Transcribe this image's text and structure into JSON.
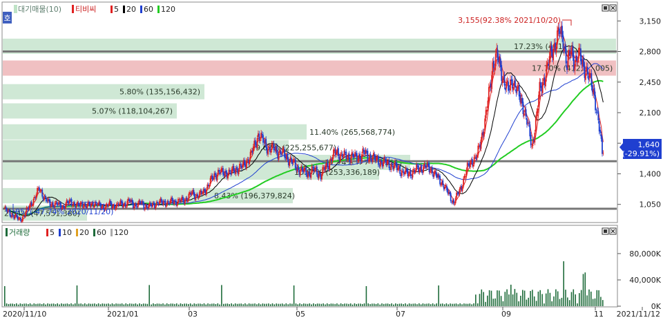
{
  "legend_price": {
    "marker": "호",
    "vp_label": "대기매물(10)",
    "candle_label": "티비씨",
    "ma": [
      {
        "label": "5",
        "color": "#e02020"
      },
      {
        "label": "20",
        "color": "#000000"
      },
      {
        "label": "60",
        "color": "#1f3fd0"
      },
      {
        "label": "120",
        "color": "#22cc22"
      }
    ]
  },
  "legend_volume": {
    "label": "거래량",
    "ma": [
      {
        "label": "5",
        "color": "#e02020"
      },
      {
        "label": "10",
        "color": "#1f3fd0"
      },
      {
        "label": "20",
        "color": "#e0a020"
      },
      {
        "label": "60",
        "color": "#1e6b3a"
      },
      {
        "label": "120",
        "color": "#aaaaaa"
      }
    ]
  },
  "price_axis": {
    "ticks": [
      "3,150",
      "2,800",
      "2,450",
      "2,100",
      "1,750",
      "1,400",
      "1,050"
    ],
    "tick_values": [
      3150,
      2800,
      2450,
      2100,
      1750,
      1400,
      1050
    ],
    "range": [
      850,
      3350
    ]
  },
  "volume_axis": {
    "ticks": [
      "80,000K",
      "40,000K",
      "0K"
    ],
    "tick_values": [
      80000,
      40000,
      0
    ],
    "range": [
      0,
      122000
    ]
  },
  "x_labels": [
    "2020/11/10",
    "2021/01",
    "03",
    "05",
    "07",
    "09",
    "11",
    "2021/11/12"
  ],
  "annotations": {
    "high": "3,155(92.38% 2021/10/20)",
    "low": "857(-47.74% 2020/11/20)"
  },
  "current_price": {
    "price": "1,640",
    "change": "(-29.91%)"
  },
  "chart_data": [
    {
      "type": "volume-profile",
      "levels": [
        {
          "price": 2860,
          "label": "17.23% (401,",
          "hl": "gray"
        },
        {
          "price": 2610,
          "label": "17.70% (412,",
          "suffix": "005)",
          "hl": "red"
        },
        {
          "price": 2340,
          "label": "5.80% (135,156,432)"
        },
        {
          "price": 2120,
          "label": "5.07% (118,104,267)"
        },
        {
          "price": 1880,
          "label": "11.40% (265,568,774)"
        },
        {
          "price": 1700,
          "label": "9.67% (225,255,677)"
        },
        {
          "price": 1530,
          "label": "11.74% (27",
          "suffix": "321)",
          "hl": "gray"
        },
        {
          "price": 1420,
          "label": "10.87% (253,336,189)"
        },
        {
          "price": 1150,
          "label": "8.43% (196,379,824)"
        },
        {
          "price": 950,
          "label": "2.04% (47,551,380)",
          "hl": "gray"
        }
      ],
      "support_lines": [
        2800,
        1545,
        1000
      ]
    },
    {
      "type": "candlestick",
      "title": "티비씨",
      "series_price": [
        [
          0,
          1000
        ],
        [
          4,
          960
        ],
        [
          8,
          930
        ],
        [
          12,
          900
        ],
        [
          16,
          870
        ],
        [
          20,
          920
        ],
        [
          24,
          990
        ],
        [
          28,
          1070
        ],
        [
          32,
          1140
        ],
        [
          36,
          1230
        ],
        [
          40,
          1150
        ],
        [
          44,
          1080
        ],
        [
          48,
          1050
        ],
        [
          52,
          1060
        ],
        [
          56,
          1040
        ],
        [
          60,
          1020
        ],
        [
          64,
          1060
        ],
        [
          68,
          1080
        ],
        [
          72,
          1050
        ],
        [
          76,
          1030
        ],
        [
          80,
          1060
        ],
        [
          84,
          1030
        ],
        [
          88,
          1040
        ],
        [
          92,
          1070
        ],
        [
          96,
          1040
        ],
        [
          100,
          1020
        ],
        [
          104,
          1030
        ],
        [
          108,
          1050
        ],
        [
          112,
          1030
        ],
        [
          116,
          1040
        ],
        [
          120,
          1060
        ],
        [
          124,
          1050
        ],
        [
          128,
          1090
        ],
        [
          132,
          1050
        ],
        [
          136,
          1040
        ],
        [
          140,
          1070
        ],
        [
          144,
          1030
        ],
        [
          148,
          1020
        ],
        [
          152,
          1050
        ],
        [
          156,
          1060
        ],
        [
          160,
          1070
        ],
        [
          164,
          1080
        ],
        [
          168,
          1060
        ],
        [
          172,
          1090
        ],
        [
          176,
          1080
        ],
        [
          180,
          1090
        ],
        [
          184,
          1100
        ],
        [
          188,
          1130
        ],
        [
          192,
          1180
        ],
        [
          196,
          1150
        ],
        [
          200,
          1160
        ],
        [
          204,
          1190
        ],
        [
          208,
          1260
        ],
        [
          212,
          1330
        ],
        [
          216,
          1390
        ],
        [
          220,
          1430
        ],
        [
          224,
          1400
        ],
        [
          228,
          1420
        ],
        [
          232,
          1410
        ],
        [
          236,
          1450
        ],
        [
          240,
          1470
        ],
        [
          244,
          1480
        ],
        [
          248,
          1550
        ],
        [
          252,
          1600
        ],
        [
          256,
          1720
        ],
        [
          260,
          1850
        ],
        [
          264,
          1790
        ],
        [
          268,
          1720
        ],
        [
          272,
          1680
        ],
        [
          276,
          1690
        ],
        [
          280,
          1650
        ],
        [
          284,
          1640
        ],
        [
          288,
          1600
        ],
        [
          292,
          1560
        ],
        [
          296,
          1520
        ],
        [
          300,
          1460
        ],
        [
          304,
          1440
        ],
        [
          308,
          1420
        ],
        [
          312,
          1400
        ],
        [
          316,
          1450
        ],
        [
          320,
          1420
        ],
        [
          324,
          1380
        ],
        [
          328,
          1460
        ],
        [
          332,
          1520
        ],
        [
          336,
          1600
        ],
        [
          340,
          1650
        ],
        [
          344,
          1620
        ],
        [
          348,
          1600
        ],
        [
          352,
          1590
        ],
        [
          356,
          1610
        ],
        [
          360,
          1580
        ],
        [
          364,
          1600
        ],
        [
          368,
          1650
        ],
        [
          372,
          1590
        ],
        [
          376,
          1600
        ],
        [
          380,
          1560
        ],
        [
          384,
          1540
        ],
        [
          388,
          1530
        ],
        [
          392,
          1520
        ],
        [
          396,
          1500
        ],
        [
          400,
          1480
        ],
        [
          404,
          1450
        ],
        [
          408,
          1420
        ],
        [
          412,
          1400
        ],
        [
          416,
          1410
        ],
        [
          420,
          1430
        ],
        [
          424,
          1460
        ],
        [
          428,
          1470
        ],
        [
          432,
          1480
        ],
        [
          436,
          1460
        ],
        [
          440,
          1400
        ],
        [
          444,
          1350
        ],
        [
          448,
          1300
        ],
        [
          452,
          1220
        ],
        [
          456,
          1150
        ],
        [
          460,
          1060
        ],
        [
          464,
          1160
        ],
        [
          468,
          1260
        ],
        [
          472,
          1400
        ],
        [
          476,
          1520
        ],
        [
          480,
          1560
        ],
        [
          484,
          1600
        ],
        [
          488,
          1800
        ],
        [
          492,
          2000
        ],
        [
          496,
          2300
        ],
        [
          500,
          2650
        ],
        [
          504,
          2750
        ],
        [
          508,
          2600
        ],
        [
          512,
          2450
        ],
        [
          516,
          2350
        ],
        [
          520,
          2480
        ],
        [
          524,
          2380
        ],
        [
          528,
          2250
        ],
        [
          532,
          2150
        ],
        [
          536,
          1950
        ],
        [
          540,
          1700
        ],
        [
          544,
          2000
        ],
        [
          548,
          2350
        ],
        [
          552,
          2480
        ],
        [
          556,
          2620
        ],
        [
          560,
          2800
        ],
        [
          564,
          2900
        ],
        [
          568,
          3020
        ],
        [
          572,
          2950
        ],
        [
          576,
          2650
        ],
        [
          580,
          2800
        ],
        [
          584,
          2700
        ],
        [
          588,
          2760
        ],
        [
          592,
          2650
        ],
        [
          596,
          2580
        ],
        [
          600,
          2450
        ],
        [
          604,
          2300
        ],
        [
          608,
          2000
        ],
        [
          612,
          1640
        ]
      ]
    }
  ]
}
